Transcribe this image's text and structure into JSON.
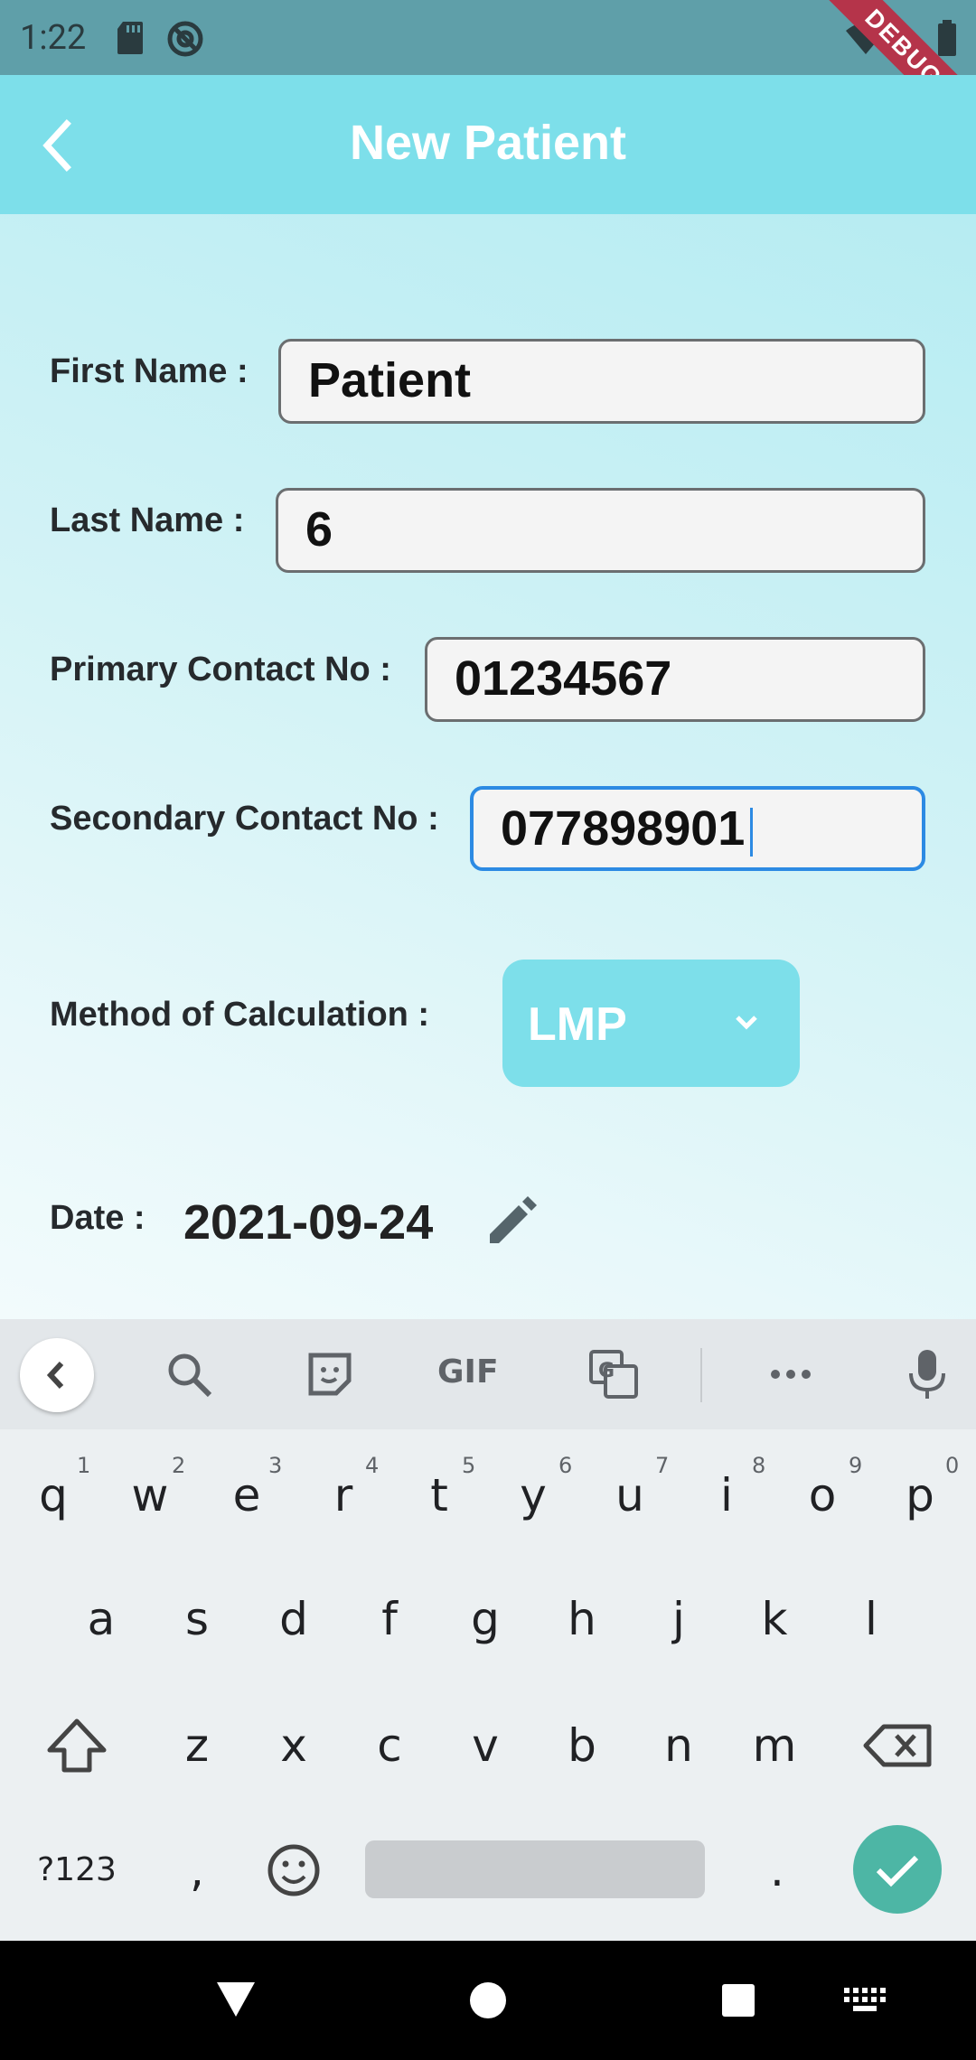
{
  "status_bar": {
    "time": "1:22",
    "debug_label": "DEBUG"
  },
  "app_bar": {
    "title": "New Patient"
  },
  "form": {
    "first_name": {
      "label": "First Name :",
      "value": "Patient"
    },
    "last_name": {
      "label": "Last Name :",
      "value": "6"
    },
    "primary_contact": {
      "label": "Primary Contact No :",
      "value": "01234567"
    },
    "secondary_contact": {
      "label": "Secondary Contact No :",
      "value": "077898901"
    },
    "method": {
      "label": "Method of Calculation :",
      "value": "LMP"
    },
    "date": {
      "label": "Date :",
      "value": "2021-09-24"
    }
  },
  "keyboard": {
    "toolbar": {
      "gif_label": "GIF"
    },
    "row1": [
      "q",
      "w",
      "e",
      "r",
      "t",
      "y",
      "u",
      "i",
      "o",
      "p"
    ],
    "row1_hints": [
      "1",
      "2",
      "3",
      "4",
      "5",
      "6",
      "7",
      "8",
      "9",
      "0"
    ],
    "row2": [
      "a",
      "s",
      "d",
      "f",
      "g",
      "h",
      "j",
      "k",
      "l"
    ],
    "row3": [
      "z",
      "x",
      "c",
      "v",
      "b",
      "n",
      "m"
    ],
    "symbols_label": "?123",
    "comma": ",",
    "period": "."
  },
  "colors": {
    "app_bar": "#7ddfea",
    "status_bar": "#5f9fa9",
    "focus_border": "#2c8ae3",
    "enter_key": "#4db6a5",
    "debug_banner": "#b5344a"
  }
}
